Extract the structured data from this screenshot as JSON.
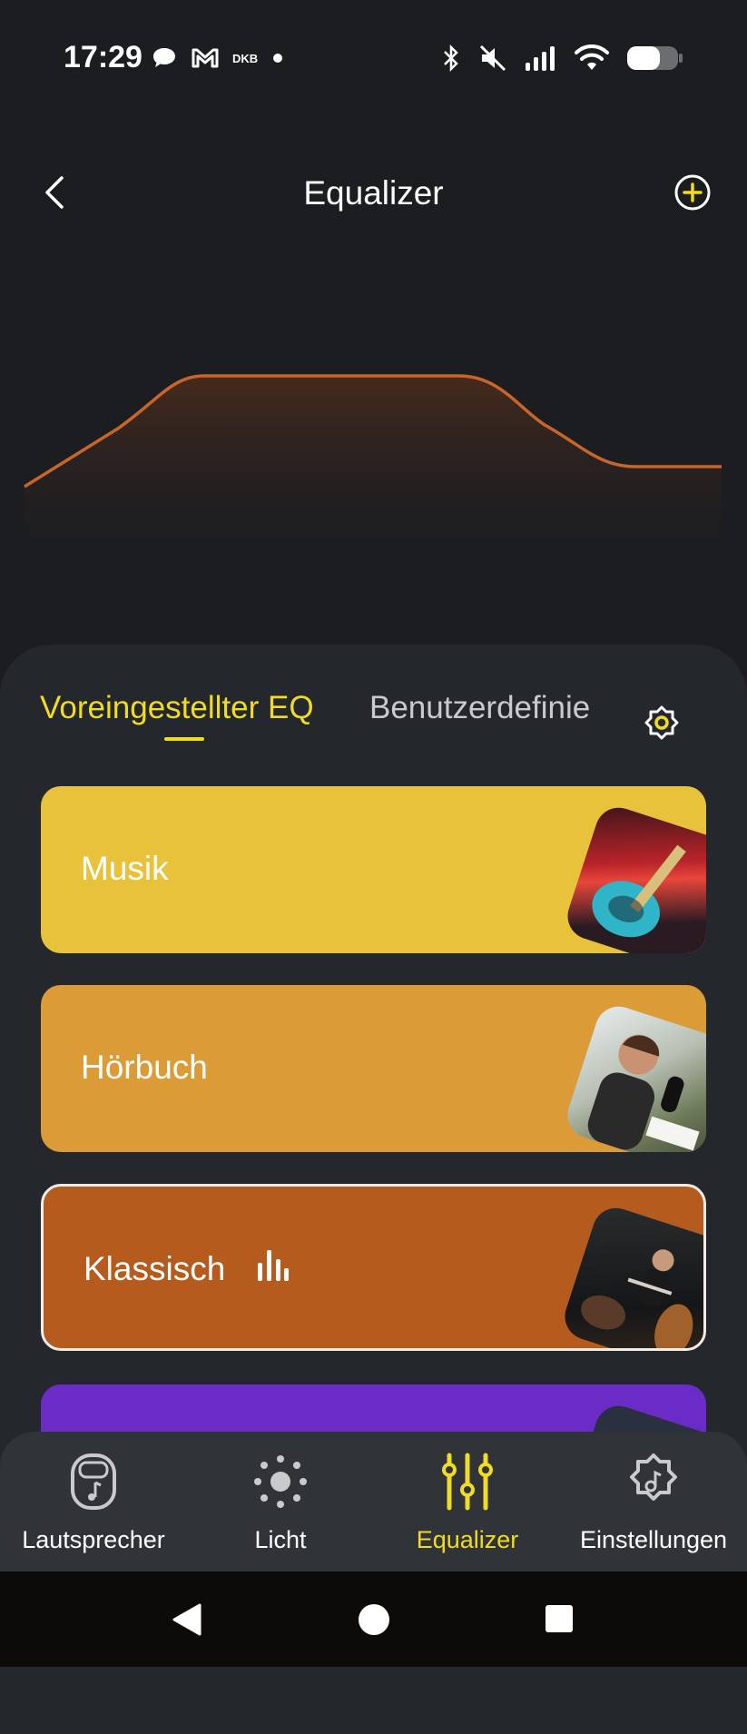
{
  "status": {
    "time": "17:29",
    "carrier_badge": "DKB"
  },
  "header": {
    "title": "Equalizer"
  },
  "tabs": [
    {
      "label": "Voreingestellter EQ",
      "active": true
    },
    {
      "label": "Benutzerdefinie",
      "active": false
    }
  ],
  "presets": [
    {
      "label": "Musik",
      "color": "#e8c23a",
      "selected": false
    },
    {
      "label": "Hörbuch",
      "color": "#db9b36",
      "selected": false
    },
    {
      "label": "Klassisch",
      "color": "#b65b1e",
      "selected": true
    },
    {
      "label": "",
      "color": "#6a2bc7",
      "selected": false
    }
  ],
  "bottom_nav": [
    {
      "label": "Lautsprecher",
      "icon": "speaker-icon",
      "active": false
    },
    {
      "label": "Licht",
      "icon": "sun-icon",
      "active": false
    },
    {
      "label": "Equalizer",
      "icon": "sliders-icon",
      "active": true
    },
    {
      "label": "Einstellungen",
      "icon": "settings-gear-icon",
      "active": false
    }
  ],
  "colors": {
    "accent": "#f1dc24",
    "curve": "#c8652a",
    "background": "#1b1d21",
    "panel": "#24272c"
  }
}
